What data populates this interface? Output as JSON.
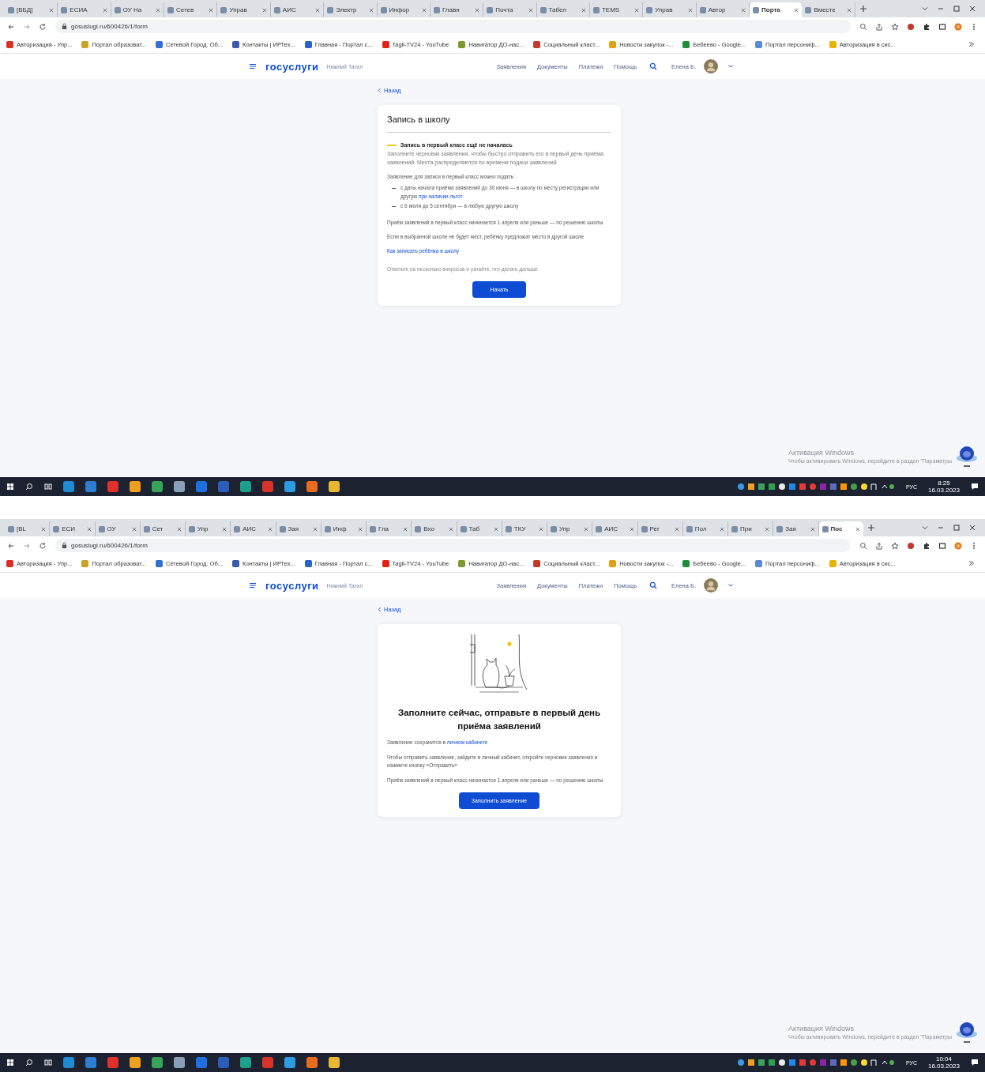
{
  "screens": [
    {
      "tabs": [
        {
          "label": "[ВБД]",
          "selected": false
        },
        {
          "label": "ЕСИА",
          "selected": false
        },
        {
          "label": "ОУ На",
          "selected": false
        },
        {
          "label": "Сетев",
          "selected": false
        },
        {
          "label": "Управ",
          "selected": false
        },
        {
          "label": "АИС",
          "selected": false
        },
        {
          "label": "Электр",
          "selected": false
        },
        {
          "label": "Инфор",
          "selected": false
        },
        {
          "label": "Главн",
          "selected": false
        },
        {
          "label": "Почта",
          "selected": false
        },
        {
          "label": "Табел",
          "selected": false
        },
        {
          "label": "ТЕМS",
          "selected": false
        },
        {
          "label": "Управ",
          "selected": false
        },
        {
          "label": "Автор",
          "selected": false
        },
        {
          "label": "Порта",
          "selected": true
        },
        {
          "label": "Вместе",
          "selected": false
        }
      ],
      "address": "gosuslugi.ru/600426/1/form",
      "bookmarks": [
        {
          "label": "Авторизация - Упр...",
          "color": "#d93025"
        },
        {
          "label": "Портал образоват...",
          "color": "#c9a227"
        },
        {
          "label": "Сетевой Город. Об...",
          "color": "#2f6fd6"
        },
        {
          "label": "Контакты | ИРТех...",
          "color": "#3b5bab"
        },
        {
          "label": "Главная - Портал с...",
          "color": "#2a63c4"
        },
        {
          "label": "Tagil-TV24 - YouTube",
          "color": "#e62117"
        },
        {
          "label": "Навигатор ДО-нас...",
          "color": "#7a9a2a"
        },
        {
          "label": "Социальный класт...",
          "color": "#c0392b"
        },
        {
          "label": "Новости закупок -...",
          "color": "#e0a010"
        },
        {
          "label": "Бебеево - Google...",
          "color": "#1e8e3e"
        },
        {
          "label": "Портал персониф...",
          "color": "#5a8ad6"
        },
        {
          "label": "Авторизация в сис...",
          "color": "#e8b400"
        }
      ],
      "header": {
        "logo": "госуслуги",
        "region": "Нижний Тагил",
        "nav": [
          "Заявления",
          "Документы",
          "Платежи",
          "Помощь"
        ],
        "user": "Елена Б."
      },
      "back": "Назад",
      "card": {
        "kind": "intro",
        "title": "Запись в школу",
        "blocks": [
          {
            "kind": "notice",
            "title": "Запись в первый класс ещё не началась",
            "text": "Заполните черновик заявления, чтобы быстро отправить его в первый день приёма заявлений. Места распределяются по времени подачи заявлений"
          },
          {
            "kind": "text",
            "text": "Заявление для записи в первый класс можно подать:"
          },
          {
            "kind": "list",
            "items": [
              {
                "text": "с даты начала приёма заявлений до 30 июня — в школу по месту регистрации или другую ",
                "link": "при наличии льгот"
              },
              {
                "text": "с 6 июля до 5 сентября — в любую другую школу"
              }
            ]
          },
          {
            "kind": "text",
            "text": "Приём заявлений в первый класс начинается 1 апреля или раньше — по решению школы"
          },
          {
            "kind": "text",
            "text": "Если в выбранной школе не будет мест, ребёнку предложат место в другой школе"
          },
          {
            "kind": "link",
            "text": "Как записать ребёнка в школу"
          },
          {
            "kind": "hint",
            "text": "Ответьте на несколько вопросов и узнайте, что делать дальше"
          }
        ],
        "button": "Начать"
      },
      "activation": {
        "title": "Активация Windows",
        "text": "Чтобы активировать Windows, перейдите в раздел \"Параметры"
      },
      "taskbar": {
        "apps": [
          {
            "color": "#1f8ad6"
          },
          {
            "color": "#2d7dd2"
          },
          {
            "color": "#e0302a"
          },
          {
            "color": "#f0a020"
          },
          {
            "color": "#3aa35a"
          },
          {
            "color": "#8aa0b8"
          },
          {
            "color": "#1e6fe0"
          },
          {
            "color": "#2b5eb8"
          },
          {
            "color": "#1f9e8a"
          },
          {
            "color": "#d8342c"
          },
          {
            "color": "#2d9be0"
          },
          {
            "color": "#e86c1c"
          },
          {
            "color": "#e8b830"
          }
        ],
        "lang": "РУС",
        "time": "8:25",
        "date": "16.03.2023"
      }
    },
    {
      "tabs": [
        {
          "label": "[ВL",
          "selected": false
        },
        {
          "label": "ЕСИ",
          "selected": false
        },
        {
          "label": "ОУ",
          "selected": false
        },
        {
          "label": "Сет",
          "selected": false
        },
        {
          "label": "Упр",
          "selected": false
        },
        {
          "label": "АИС",
          "selected": false
        },
        {
          "label": "Зая",
          "selected": false
        },
        {
          "label": "Инф",
          "selected": false
        },
        {
          "label": "Гла",
          "selected": false
        },
        {
          "label": "Вхо",
          "selected": false
        },
        {
          "label": "Таб",
          "selected": false
        },
        {
          "label": "ТКУ",
          "selected": false
        },
        {
          "label": "Упр",
          "selected": false
        },
        {
          "label": "АИС",
          "selected": false
        },
        {
          "label": "Рег",
          "selected": false
        },
        {
          "label": "Пол",
          "selected": false
        },
        {
          "label": "При",
          "selected": false
        },
        {
          "label": "Зая",
          "selected": false
        },
        {
          "label": "Пос",
          "selected": true
        }
      ],
      "address": "gosuslugi.ru/600426/1/form",
      "bookmarks": [
        {
          "label": "Авторизация - Упр...",
          "color": "#d93025"
        },
        {
          "label": "Портал образоват...",
          "color": "#c9a227"
        },
        {
          "label": "Сетевой Город. Об...",
          "color": "#2f6fd6"
        },
        {
          "label": "Контакты | ИРТех...",
          "color": "#3b5bab"
        },
        {
          "label": "Главная - Портал с...",
          "color": "#2a63c4"
        },
        {
          "label": "Tagil-TV24 - YouTube",
          "color": "#e62117"
        },
        {
          "label": "Навигатор ДО-нас...",
          "color": "#7a9a2a"
        },
        {
          "label": "Социальный класт...",
          "color": "#c0392b"
        },
        {
          "label": "Новости закупок -...",
          "color": "#e0a010"
        },
        {
          "label": "Бебеево - Google...",
          "color": "#1e8e3e"
        },
        {
          "label": "Портал персониф...",
          "color": "#5a8ad6"
        },
        {
          "label": "Авторизация в сис...",
          "color": "#e8b400"
        }
      ],
      "header": {
        "logo": "госуслуги",
        "region": "Нижний Тагил",
        "nav": [
          "Заявления",
          "Документы",
          "Платежи",
          "Помощь"
        ],
        "user": "Елена Б."
      },
      "back": "Назад",
      "card": {
        "kind": "draft",
        "title": "Заполните сейчас, отправьте в первый день приёма заявлений",
        "blocks": [
          {
            "kind": "text",
            "text": "Заявление сохранится в ",
            "link": "личном кабинете"
          },
          {
            "kind": "text",
            "text": "Чтобы отправить заявление, зайдите в личный кабинет, откройте черновик заявления и нажмите кнопку «Отправить»"
          },
          {
            "kind": "text",
            "text": "Приём заявлений в первый класс начинается 1 апреля или раньше — по решению школы"
          }
        ],
        "button": "Заполнить заявление"
      },
      "activation": {
        "title": "Активация Windows",
        "text": "Чтобы активировать Windows, перейдите в раздел \"Параметры"
      },
      "taskbar": {
        "apps": [
          {
            "color": "#1f8ad6"
          },
          {
            "color": "#2d7dd2"
          },
          {
            "color": "#e0302a"
          },
          {
            "color": "#f0a020"
          },
          {
            "color": "#3aa35a"
          },
          {
            "color": "#8aa0b8"
          },
          {
            "color": "#1e6fe0"
          },
          {
            "color": "#2b5eb8"
          },
          {
            "color": "#1f9e8a"
          },
          {
            "color": "#d8342c"
          },
          {
            "color": "#2d9be0"
          },
          {
            "color": "#e86c1c"
          },
          {
            "color": "#e8b830"
          }
        ],
        "lang": "РУС",
        "time": "10:04",
        "date": "16.03.2023"
      }
    }
  ]
}
